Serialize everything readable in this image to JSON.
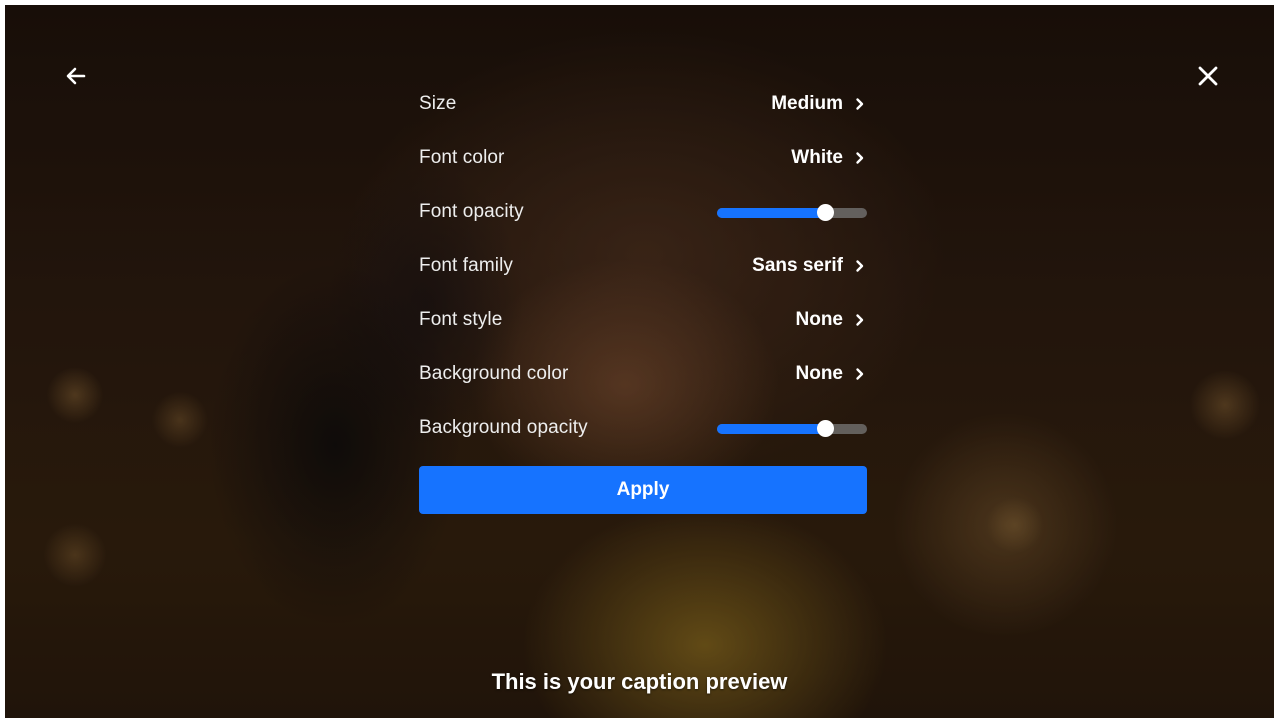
{
  "settings": {
    "rows": [
      {
        "label": "Size",
        "value": "Medium"
      },
      {
        "label": "Font color",
        "value": "White"
      },
      {
        "label": "Font opacity",
        "slider_level": 0.72
      },
      {
        "label": "Font family",
        "value": "Sans serif"
      },
      {
        "label": "Font style",
        "value": "None"
      },
      {
        "label": "Background color",
        "value": "None"
      },
      {
        "label": "Background opacity",
        "slider_level": 0.72
      }
    ],
    "apply_label": "Apply"
  },
  "caption": {
    "preview_text": "This is your caption preview"
  },
  "icons": {
    "back": "arrow-left-icon",
    "close": "close-icon",
    "chevron": "chevron-right-icon"
  },
  "colors": {
    "accent": "#1673ff",
    "slider_track": "#787878",
    "text": "#ffffff"
  }
}
